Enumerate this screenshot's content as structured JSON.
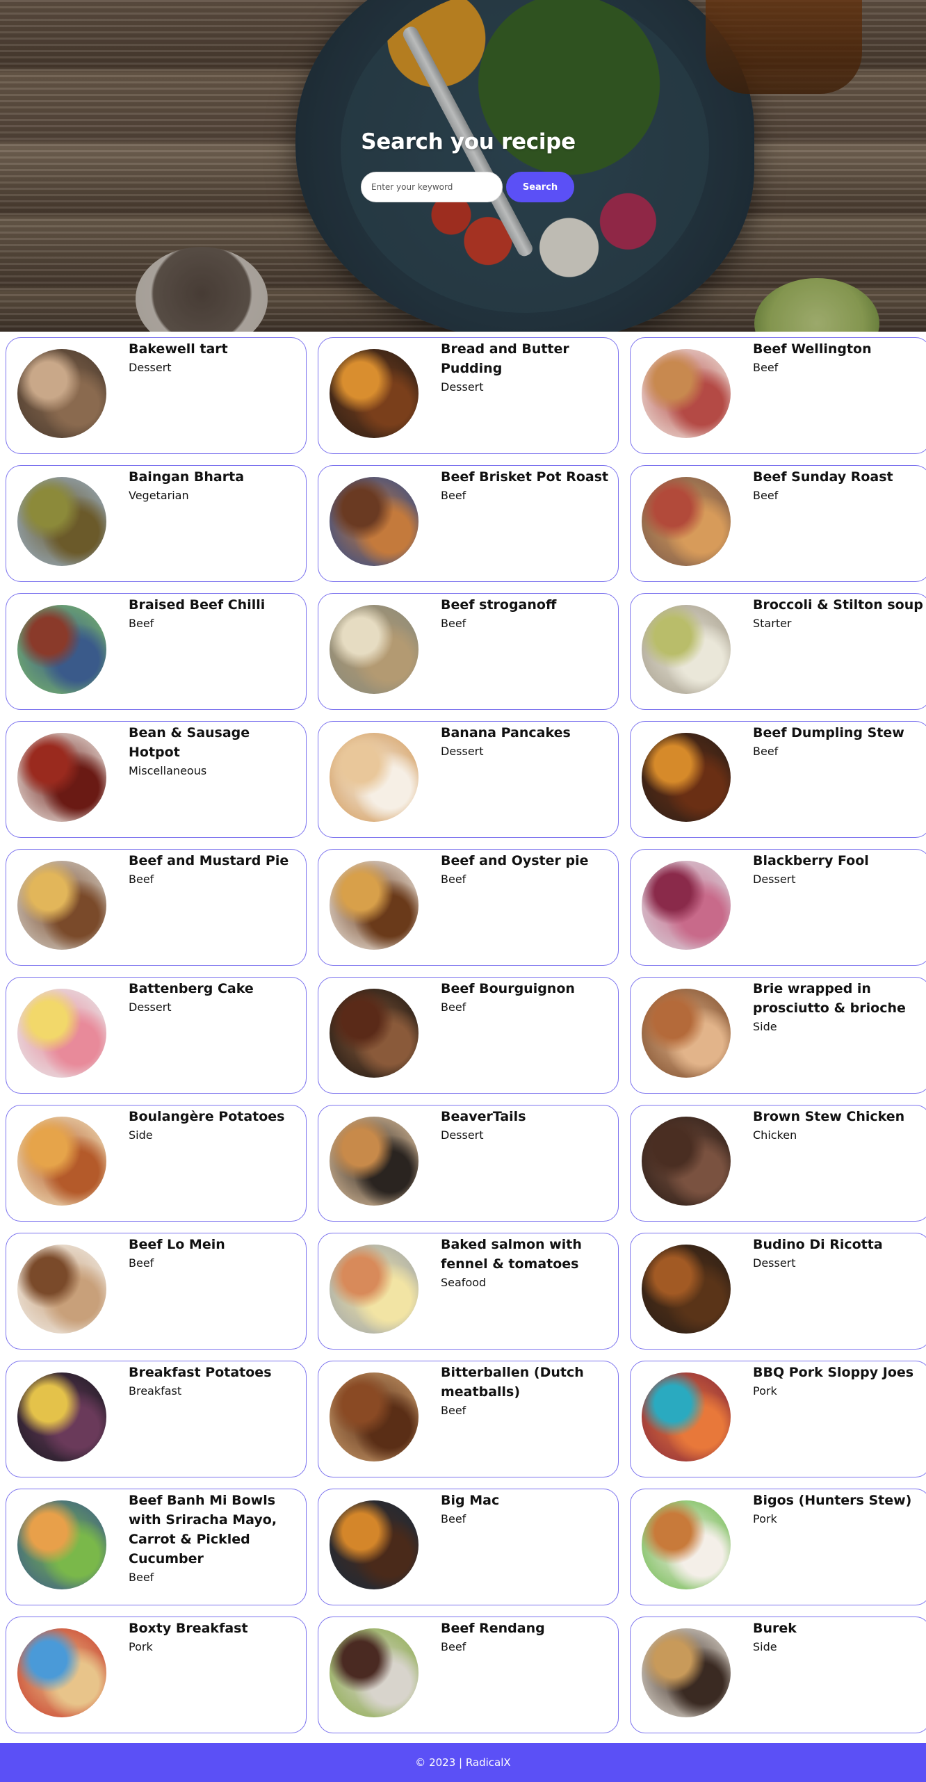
{
  "hero": {
    "title": "Search you recipe",
    "search_placeholder": "Enter your keyword",
    "search_button": "Search"
  },
  "recipes": [
    {
      "name": "Bakewell tart",
      "category": "Dessert",
      "thumb": [
        "#c9a889",
        "#8a6a4f",
        "#4a3a2e"
      ]
    },
    {
      "name": "Bread and Butter Pudding",
      "category": "Dessert",
      "thumb": [
        "#d98e2f",
        "#7a3f1b",
        "#2a1e17"
      ]
    },
    {
      "name": "Beef Wellington",
      "category": "Beef",
      "thumb": [
        "#c8894f",
        "#b44a45",
        "#f1e9e2"
      ]
    },
    {
      "name": "Baingan Bharta",
      "category": "Vegetarian",
      "thumb": [
        "#8c8a3a",
        "#6b5a2a",
        "#9ab0c6"
      ]
    },
    {
      "name": "Beef Brisket Pot Roast",
      "category": "Beef",
      "thumb": [
        "#6a3a22",
        "#c47a3c",
        "#2f4a8a"
      ]
    },
    {
      "name": "Beef Sunday Roast",
      "category": "Beef",
      "thumb": [
        "#b24a3a",
        "#d79b5a",
        "#7a5a4a"
      ]
    },
    {
      "name": "Braised Beef Chilli",
      "category": "Beef",
      "thumb": [
        "#8a3a2a",
        "#3a5a8a",
        "#7ab86a"
      ]
    },
    {
      "name": "Beef stroganoff",
      "category": "Beef",
      "thumb": [
        "#e6dcc2",
        "#b39a72",
        "#8a8a7a"
      ]
    },
    {
      "name": "Broccoli & Stilton soup",
      "category": "Starter",
      "thumb": [
        "#b9bd6a",
        "#eae7d9",
        "#a59d8c"
      ]
    },
    {
      "name": "Bean & Sausage Hotpot",
      "category": "Miscellaneous",
      "thumb": [
        "#9a2a1e",
        "#6a1a14",
        "#f2eee8"
      ]
    },
    {
      "name": "Banana Pancakes",
      "category": "Dessert",
      "thumb": [
        "#e9c79a",
        "#f6efe5",
        "#d29a5a"
      ]
    },
    {
      "name": "Beef Dumpling Stew",
      "category": "Beef",
      "thumb": [
        "#d68a2a",
        "#6a2f14",
        "#2b1f18"
      ]
    },
    {
      "name": "Beef and Mustard Pie",
      "category": "Beef",
      "thumb": [
        "#e2b65a",
        "#7a4a2a",
        "#d5d0c8"
      ]
    },
    {
      "name": "Beef and Oyster pie",
      "category": "Beef",
      "thumb": [
        "#d8a04a",
        "#6a3a1a",
        "#f2ece4"
      ]
    },
    {
      "name": "Blackberry Fool",
      "category": "Dessert",
      "thumb": [
        "#8a2a4a",
        "#c86a8a",
        "#d8d2da"
      ]
    },
    {
      "name": "Battenberg Cake",
      "category": "Dessert",
      "thumb": [
        "#f2d86a",
        "#e88a9a",
        "#e8eaec"
      ]
    },
    {
      "name": "Beef Bourguignon",
      "category": "Beef",
      "thumb": [
        "#5a2a18",
        "#8a5a3a",
        "#1a1612"
      ]
    },
    {
      "name": "Brie wrapped in prosciutto & brioche",
      "category": "Side",
      "thumb": [
        "#b46a3a",
        "#e2b48a",
        "#7a4a2a"
      ]
    },
    {
      "name": "Boulangère Potatoes",
      "category": "Side",
      "thumb": [
        "#e6a44a",
        "#b45a2a",
        "#f3e6c2"
      ]
    },
    {
      "name": "BeaverTails",
      "category": "Dessert",
      "thumb": [
        "#c88a4a",
        "#2a2420",
        "#e2c4a0"
      ]
    },
    {
      "name": "Brown Stew Chicken",
      "category": "Chicken",
      "thumb": [
        "#4a2e22",
        "#7a5240",
        "#2a1c16"
      ]
    },
    {
      "name": "Beef Lo Mein",
      "category": "Beef",
      "thumb": [
        "#7a4a2a",
        "#c8a07a",
        "#f2eee8"
      ]
    },
    {
      "name": "Baked salmon with fennel & tomatoes",
      "category": "Seafood",
      "thumb": [
        "#d88a5a",
        "#f2e4a4",
        "#a0a6aa"
      ]
    },
    {
      "name": "Budino Di Ricotta",
      "category": "Dessert",
      "thumb": [
        "#a25a24",
        "#5a3418",
        "#2a1e16"
      ]
    },
    {
      "name": "Breakfast Potatoes",
      "category": "Breakfast",
      "thumb": [
        "#e4c24a",
        "#6a3a5a",
        "#1a1a22"
      ]
    },
    {
      "name": "Bitterballen (Dutch meatballs)",
      "category": "Beef",
      "thumb": [
        "#8a4a24",
        "#5a2e16",
        "#c89a6a"
      ]
    },
    {
      "name": "BBQ Pork Sloppy Joes",
      "category": "Pork",
      "thumb": [
        "#2aaac0",
        "#e8783a",
        "#8a2a3a"
      ]
    },
    {
      "name": "Beef Banh Mi Bowls with Sriracha Mayo, Carrot & Pickled Cucumber",
      "category": "Beef",
      "thumb": [
        "#e8a04a",
        "#7ab84a",
        "#3a5a8a"
      ]
    },
    {
      "name": "Big Mac",
      "category": "Beef",
      "thumb": [
        "#d4862a",
        "#4a2a1a",
        "#1a2a3a"
      ]
    },
    {
      "name": "Bigos (Hunters Stew)",
      "category": "Pork",
      "thumb": [
        "#c87a3a",
        "#f4efe8",
        "#6ab84a"
      ]
    },
    {
      "name": "Boxty Breakfast",
      "category": "Pork",
      "thumb": [
        "#4a9ad8",
        "#e8c48a",
        "#c83a2a"
      ]
    },
    {
      "name": "Beef Rendang",
      "category": "Beef",
      "thumb": [
        "#4a2a22",
        "#d8d4cc",
        "#8aaa4a"
      ]
    },
    {
      "name": "Burek",
      "category": "Side",
      "thumb": [
        "#c89a5a",
        "#3a2a22",
        "#e8e2d8"
      ]
    }
  ],
  "footer": {
    "text": "© 2023 | RadicalX"
  },
  "colors": {
    "accent": "#5b50f6",
    "card_border": "#7b72ee"
  }
}
